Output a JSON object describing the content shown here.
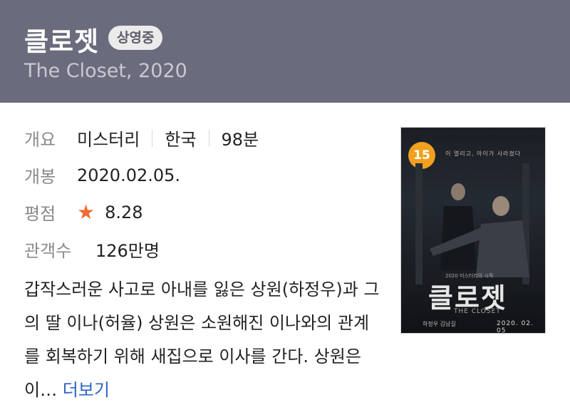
{
  "header": {
    "title": "클로젯",
    "badge": "상영중",
    "subtitle": "The Closet, 2020"
  },
  "info": {
    "overview_label": "개요",
    "genre": "미스터리",
    "country": "한국",
    "runtime": "98분",
    "release_label": "개봉",
    "release_date": "2020.02.05.",
    "rating_label": "평점",
    "rating": "8.28",
    "audience_label": "관객수",
    "audience": "126만명"
  },
  "synopsis": {
    "text": "갑작스러운 사고로 아내를 잃은 상원(하정우)과 그의 딸 이나(허율) 상원은 소원해진 이나와의 관계를 회복하기 위해 새집으로 이사를 간다. 상원은 이…",
    "more": "더보기"
  },
  "poster": {
    "age_rating": "15",
    "tagline": "이 열리고, 아이가 사라졌다",
    "small_text": "2020 미스터리의 시작",
    "title": "클로젯",
    "subtitle": "THE CLOSET",
    "cast": "하정우 김남길",
    "date": "2020. 02. 05"
  },
  "colors": {
    "header_bg": "#6b6b7e",
    "star": "#f06a32",
    "link": "#2b63c6",
    "age_badge": "#f1a01f"
  },
  "icons": {
    "star": "star-icon"
  }
}
